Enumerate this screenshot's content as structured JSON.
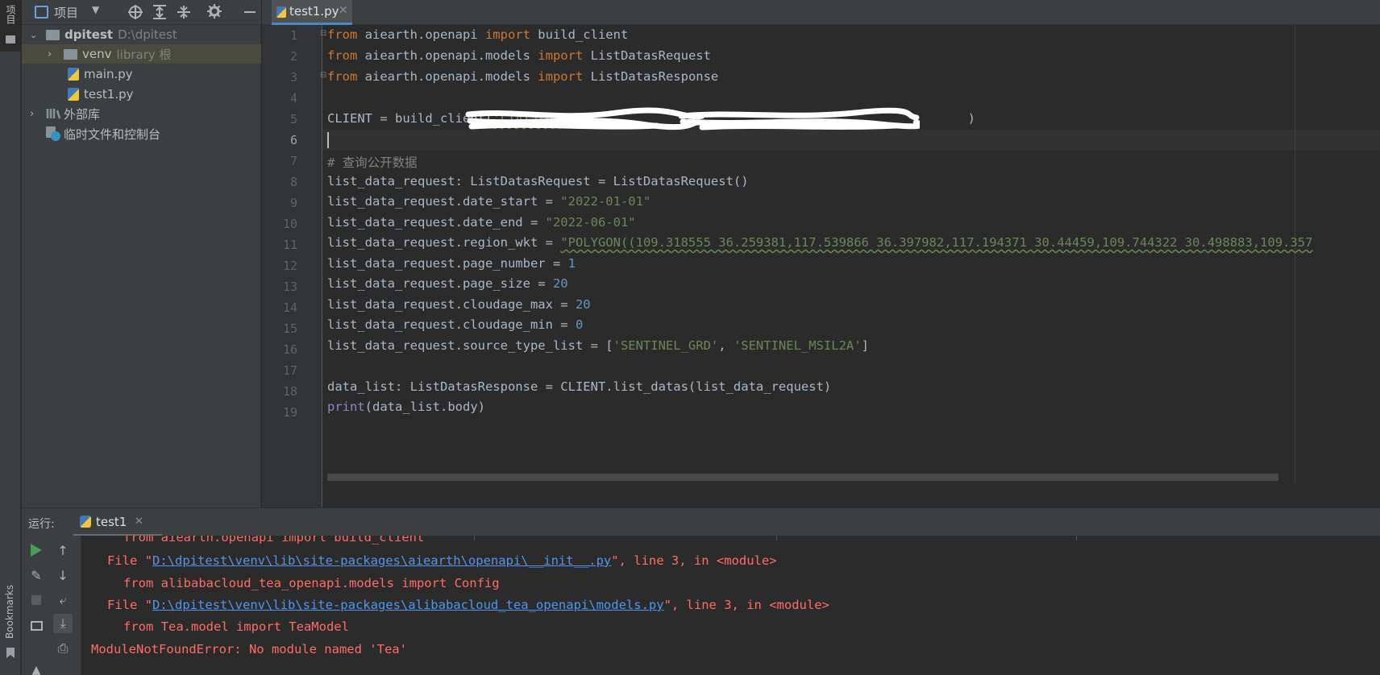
{
  "left_stripe": {
    "project_tab": "项目",
    "bookmarks_tab": "Bookmarks"
  },
  "project_toolbar": {
    "title": "项目"
  },
  "tree": [
    {
      "name": "dpitest",
      "path": "D:\\dpitest"
    },
    {
      "name": "venv",
      "note": "library 根"
    },
    {
      "name": "main.py"
    },
    {
      "name": "test1.py"
    },
    {
      "name": "外部库"
    },
    {
      "name": "临时文件和控制台"
    }
  ],
  "editor": {
    "tab_label": "test1.py",
    "current_line": 6,
    "line_numbers": [
      "1",
      "2",
      "3",
      "4",
      "5",
      "6",
      "7",
      "8",
      "9",
      "10",
      "11",
      "12",
      "13",
      "14",
      "15",
      "16",
      "17",
      "18",
      "19"
    ],
    "lines": {
      "l1": {
        "kw1": "from",
        "mod": " aiearth.openapi ",
        "kw2": "import",
        "name": " build_client"
      },
      "l2": {
        "kw1": "from",
        "mod": " aiearth.openapi.models ",
        "kw2": "import",
        "name": " ListDatasRequest"
      },
      "l3": {
        "kw1": "from",
        "mod": " aiearth.openapi.models ",
        "kw2": "import",
        "name": " ListDatasResponse"
      },
      "l5": {
        "pre": "CLIENT = build_client(",
        "s1": "'LTAI5tbg",
        "sep": "',",
        "s2": "'",
        "post": ")"
      },
      "l7": "# 查询公开数据",
      "l8": "list_data_request: ListDatasRequest = ListDatasRequest()",
      "l9": {
        "pre": "list_data_request.date_start = ",
        "val": "\"2022-01-01\""
      },
      "l10": {
        "pre": "list_data_request.date_end = ",
        "val": "\"2022-06-01\""
      },
      "l11": {
        "pre": "list_data_request.region_wkt = ",
        "val": "\"POLYGON((109.318555 36.259381,117.539866 36.397982,117.194371 30.44459,109.744322 30.498883,109.357"
      },
      "l12": {
        "pre": "list_data_request.page_number = ",
        "val": "1"
      },
      "l13": {
        "pre": "list_data_request.page_size = ",
        "val": "20"
      },
      "l14": {
        "pre": "list_data_request.cloudage_max = ",
        "val": "20"
      },
      "l15": {
        "pre": "list_data_request.cloudage_min = ",
        "val": "0"
      },
      "l16": {
        "pre": "list_data_request.source_type_list = [",
        "v1": "'SENTINEL_GRD'",
        "sep": ", ",
        "v2": "'SENTINEL_MSIL2A'",
        "post": "]"
      },
      "l18": "data_list: ListDatasResponse = CLIENT.list_datas(list_data_request)",
      "l19": {
        "fn": "print",
        "args": "(data_list.body)"
      }
    }
  },
  "run": {
    "label": "运行:",
    "tab_label": "test1",
    "console": {
      "c0": "from aiearth.openapi import build_client",
      "c1": {
        "pre": "File \"",
        "link": "D:\\dpitest\\venv\\lib\\site-packages\\aiearth\\openapi\\__init__.py",
        "post": "\", line 3, in <module>"
      },
      "c2": "from alibabacloud_tea_openapi.models import Config",
      "c3": {
        "pre": "File \"",
        "link": "D:\\dpitest\\venv\\lib\\site-packages\\alibabacloud_tea_openapi\\models.py",
        "post": "\", line 3, in <module>"
      },
      "c4": "from Tea.model import TeaModel",
      "c5": "ModuleNotFoundError: No module named 'Tea'"
    }
  },
  "colors": {
    "keyword": "#cc7832",
    "string": "#6a8759",
    "number": "#6897bb",
    "error": "#ff6b68",
    "link": "#5394ec"
  }
}
